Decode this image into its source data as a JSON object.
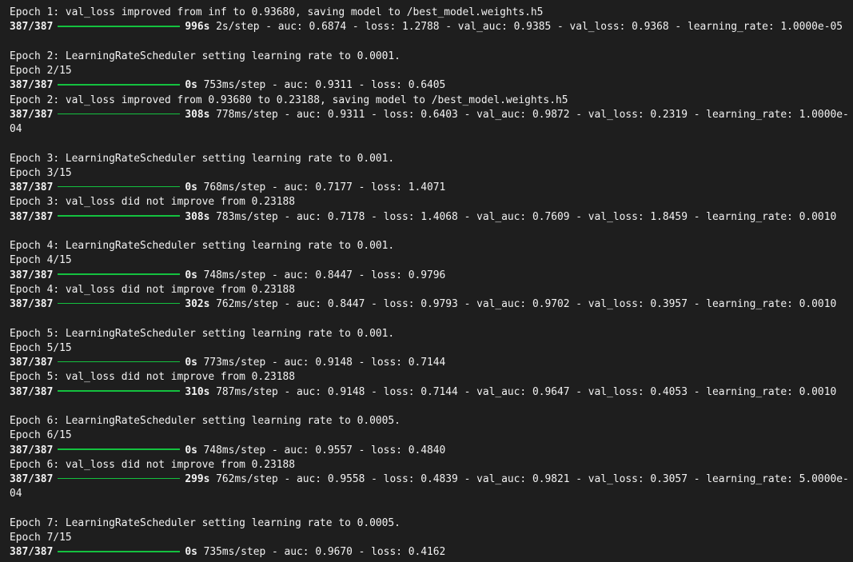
{
  "log": {
    "step_count": "387/387",
    "bar_fill_fraction": 1.0,
    "bar_color": "#14c13f",
    "lines": [
      {
        "type": "text",
        "text": "Epoch 1: val_loss improved from inf to 0.93680, saving model to /best_model.weights.h5"
      },
      {
        "type": "progress",
        "time": "996s",
        "rest": " 2s/step - auc: 0.6874 - loss: 1.2788 - val_auc: 0.9385 - val_loss: 0.9368 - learning_rate: 1.0000e-05"
      },
      {
        "type": "blank"
      },
      {
        "type": "text",
        "text": "Epoch 2: LearningRateScheduler setting learning rate to 0.0001."
      },
      {
        "type": "text",
        "text": "Epoch 2/15"
      },
      {
        "type": "progress",
        "time": "0s",
        "rest": " 753ms/step - auc: 0.9311 - loss: 0.6405"
      },
      {
        "type": "text",
        "text": "Epoch 2: val_loss improved from 0.93680 to 0.23188, saving model to /best_model.weights.h5"
      },
      {
        "type": "progress",
        "time": "308s",
        "rest": " 778ms/step - auc: 0.9311 - loss: 0.6403 - val_auc: 0.9872 - val_loss: 0.2319 - learning_rate: 1.0000e-"
      },
      {
        "type": "text",
        "text": "04"
      },
      {
        "type": "blank"
      },
      {
        "type": "text",
        "text": "Epoch 3: LearningRateScheduler setting learning rate to 0.001."
      },
      {
        "type": "text",
        "text": "Epoch 3/15"
      },
      {
        "type": "progress",
        "time": "0s",
        "rest": " 768ms/step - auc: 0.7177 - loss: 1.4071"
      },
      {
        "type": "text",
        "text": "Epoch 3: val_loss did not improve from 0.23188"
      },
      {
        "type": "progress",
        "time": "308s",
        "rest": " 783ms/step - auc: 0.7178 - loss: 1.4068 - val_auc: 0.7609 - val_loss: 1.8459 - learning_rate: 0.0010"
      },
      {
        "type": "blank"
      },
      {
        "type": "text",
        "text": "Epoch 4: LearningRateScheduler setting learning rate to 0.001."
      },
      {
        "type": "text",
        "text": "Epoch 4/15"
      },
      {
        "type": "progress",
        "time": "0s",
        "rest": " 748ms/step - auc: 0.8447 - loss: 0.9796"
      },
      {
        "type": "text",
        "text": "Epoch 4: val_loss did not improve from 0.23188"
      },
      {
        "type": "progress",
        "time": "302s",
        "rest": " 762ms/step - auc: 0.8447 - loss: 0.9793 - val_auc: 0.9702 - val_loss: 0.3957 - learning_rate: 0.0010"
      },
      {
        "type": "blank"
      },
      {
        "type": "text",
        "text": "Epoch 5: LearningRateScheduler setting learning rate to 0.001."
      },
      {
        "type": "text",
        "text": "Epoch 5/15"
      },
      {
        "type": "progress",
        "time": "0s",
        "rest": " 773ms/step - auc: 0.9148 - loss: 0.7144"
      },
      {
        "type": "text",
        "text": "Epoch 5: val_loss did not improve from 0.23188"
      },
      {
        "type": "progress",
        "time": "310s",
        "rest": " 787ms/step - auc: 0.9148 - loss: 0.7144 - val_auc: 0.9647 - val_loss: 0.4053 - learning_rate: 0.0010"
      },
      {
        "type": "blank"
      },
      {
        "type": "text",
        "text": "Epoch 6: LearningRateScheduler setting learning rate to 0.0005."
      },
      {
        "type": "text",
        "text": "Epoch 6/15"
      },
      {
        "type": "progress",
        "time": "0s",
        "rest": " 748ms/step - auc: 0.9557 - loss: 0.4840"
      },
      {
        "type": "text",
        "text": "Epoch 6: val_loss did not improve from 0.23188"
      },
      {
        "type": "progress",
        "time": "299s",
        "rest": " 762ms/step - auc: 0.9558 - loss: 0.4839 - val_auc: 0.9821 - val_loss: 0.3057 - learning_rate: 5.0000e-"
      },
      {
        "type": "text",
        "text": "04"
      },
      {
        "type": "blank"
      },
      {
        "type": "text",
        "text": "Epoch 7: LearningRateScheduler setting learning rate to 0.0005."
      },
      {
        "type": "text",
        "text": "Epoch 7/15"
      },
      {
        "type": "progress",
        "time": "0s",
        "rest": " 735ms/step - auc: 0.9670 - loss: 0.4162"
      }
    ]
  }
}
